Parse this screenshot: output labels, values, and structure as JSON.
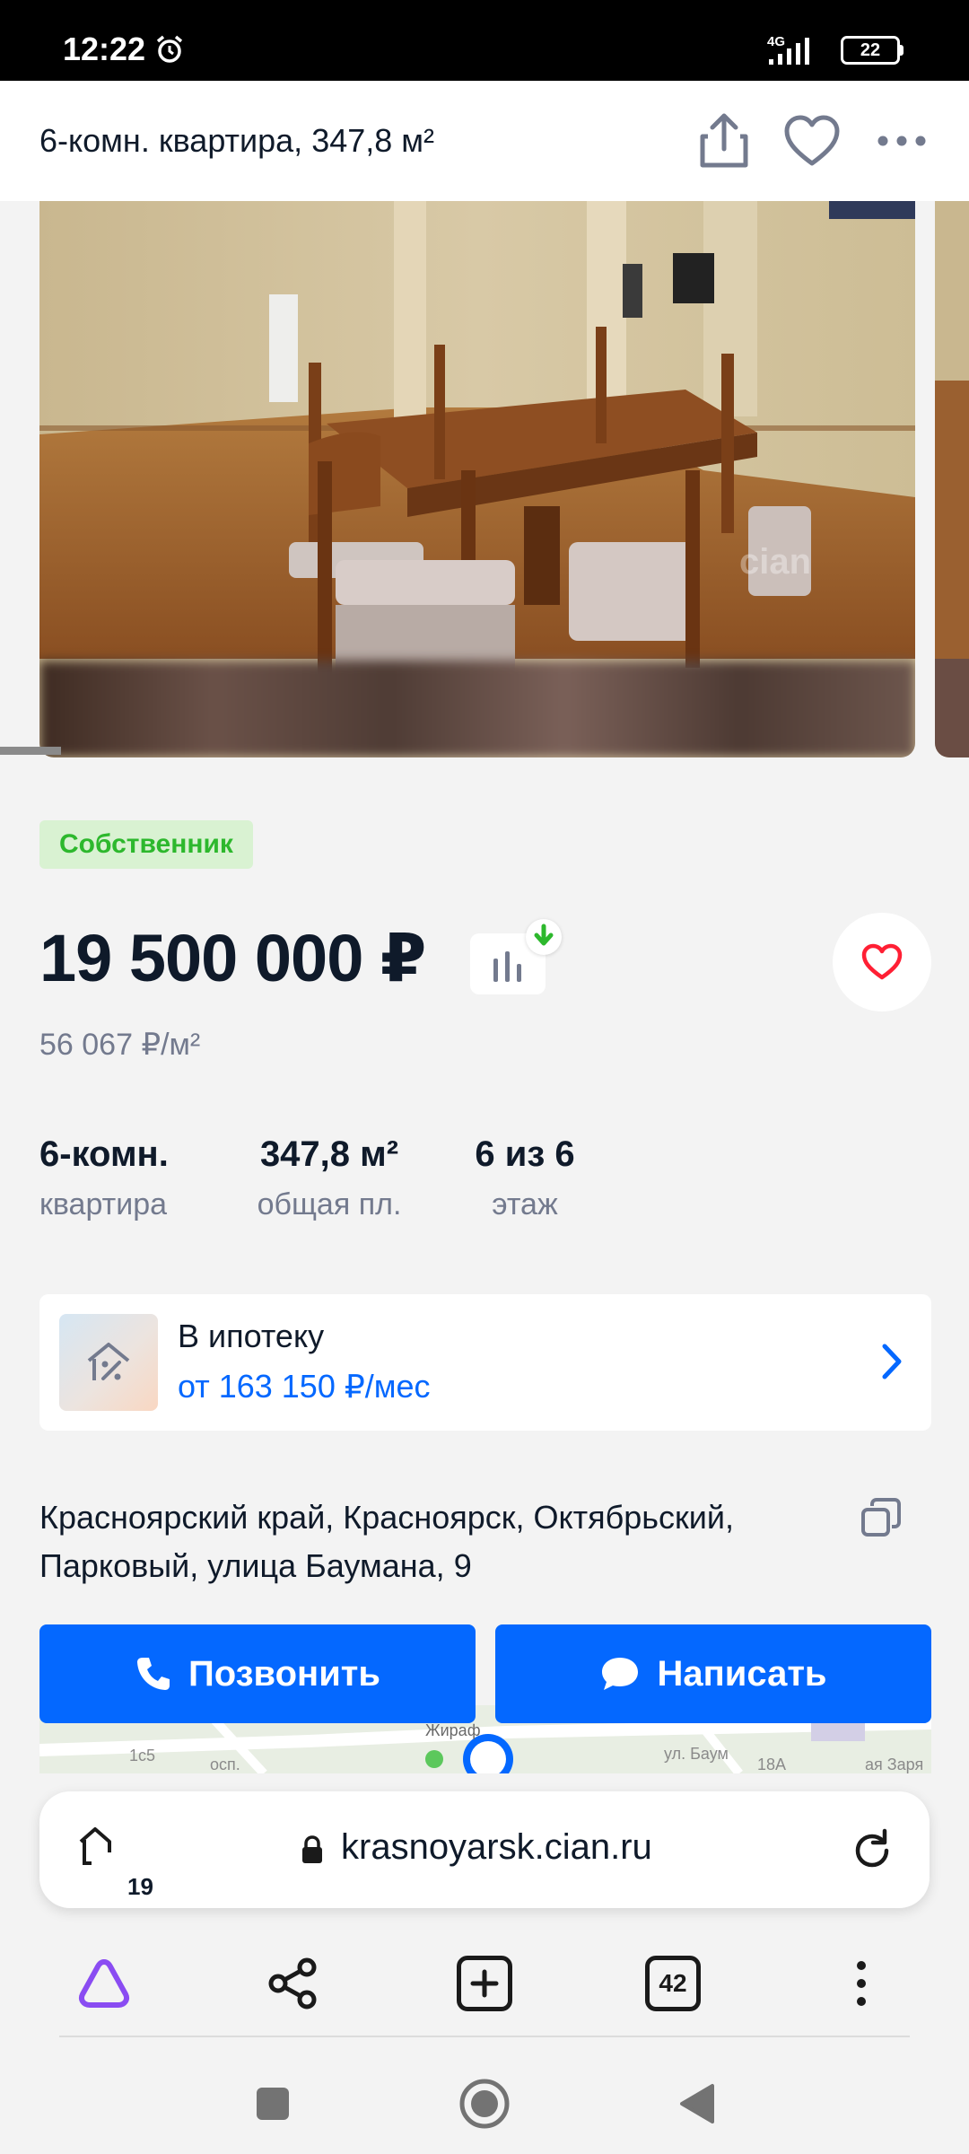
{
  "status_bar": {
    "time": "12:22",
    "network": "4G",
    "battery": "22"
  },
  "header": {
    "title": "6-комн. квартира, 347,8 м²"
  },
  "gallery": {
    "watermark": "cian"
  },
  "listing": {
    "badge": "Собственник",
    "price": "19 500 000 ₽",
    "price_per_m2": "56 067 ₽/м²",
    "params": [
      {
        "value": "6-комн.",
        "label": "квартира"
      },
      {
        "value": "347,8 м²",
        "label": "общая пл."
      },
      {
        "value": "6 из 6",
        "label": "этаж"
      }
    ],
    "mortgage": {
      "title": "В ипотеку",
      "subtitle": "от 163 150 ₽/мес"
    },
    "address": "Красноярский край, Красноярск, Октябрьский, Парковый, улица Баумана, 9",
    "call_label": "Позвонить",
    "write_label": "Написать"
  },
  "map": {
    "labels": [
      "1c5",
      "осп.",
      "Жираф",
      "ул. Баум",
      "18А",
      "ая Заря"
    ]
  },
  "browser": {
    "tabs_count": "19",
    "url": "krasnoyarsk.cian.ru",
    "open_tabs": "42"
  },
  "colors": {
    "accent": "#0468ff",
    "owner_green": "#2db82d",
    "heart_red": "#ff1f34"
  }
}
